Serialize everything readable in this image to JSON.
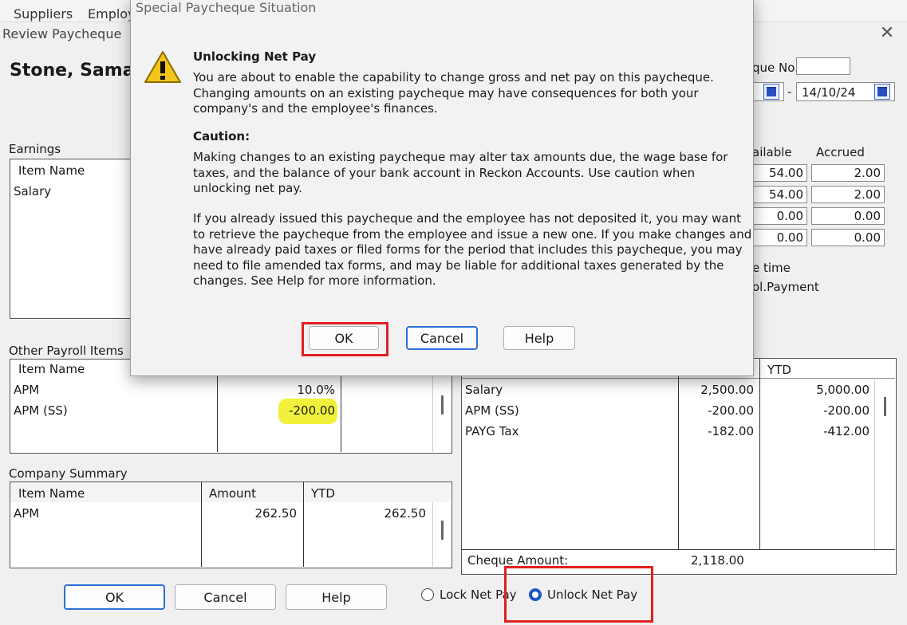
{
  "menubar": {
    "items": [
      "Suppliers",
      "Employ"
    ]
  },
  "background_window": {
    "title": "Review Paycheque",
    "employee_name": "Stone, Sama",
    "cheque_no_label": "que No.",
    "cheque_no_value": "",
    "period_separator": "-",
    "period_end": "14/10/24",
    "earnings": {
      "label": "Earnings",
      "col_item_name": "Item Name",
      "rows": [
        "Salary"
      ]
    },
    "leave": {
      "col_available": "ailable",
      "col_accrued": "Accrued",
      "rows": [
        {
          "available": "54.00",
          "accrued": "2.00"
        },
        {
          "available": "54.00",
          "accrued": "2.00"
        },
        {
          "available": "0.00",
          "accrued": "0.00"
        },
        {
          "available": "0.00",
          "accrued": "0.00"
        }
      ],
      "note1": "e time",
      "note2": "ol.Payment"
    },
    "other_payroll_items": {
      "label": "Other Payroll Items",
      "col_item_name": "Item Name",
      "rows": [
        {
          "name": "APM",
          "rate": "10.0%"
        },
        {
          "name": "APM (SS)",
          "rate": "-200.00"
        }
      ]
    },
    "summary": {
      "col_ytd": "YTD",
      "rows": [
        {
          "name": "Salary",
          "current": "2,500.00",
          "ytd": "5,000.00"
        },
        {
          "name": "APM (SS)",
          "current": "-200.00",
          "ytd": "-200.00"
        },
        {
          "name": "PAYG Tax",
          "current": "-182.00",
          "ytd": "-412.00"
        }
      ],
      "cheque_amount_label": "Cheque Amount:",
      "cheque_amount_value": "2,118.00"
    },
    "company_summary": {
      "label": "Company Summary",
      "col_item_name": "Item Name",
      "col_amount": "Amount",
      "col_ytd": "YTD",
      "rows": [
        {
          "name": "APM",
          "amount": "262.50",
          "ytd": "262.50"
        }
      ]
    },
    "buttons": {
      "ok": "OK",
      "cancel": "Cancel",
      "help": "Help"
    },
    "radio": {
      "lock": "Lock Net Pay",
      "unlock": "Unlock Net Pay",
      "selected": "unlock"
    }
  },
  "dialog": {
    "title": "Special Paycheque Situation",
    "heading": "Unlocking Net Pay",
    "intro": [
      "You are about to enable the capability to change gross and net pay on this paycheque.",
      "Changing amounts on an existing paycheque may have consequences for both your",
      "company's and the employee's finances."
    ],
    "caution_heading": "Caution:",
    "caution": [
      "Making changes to an existing paycheque may alter tax amounts due, the wage base for",
      "taxes, and the balance of your bank account in Reckon Accounts. Use caution when",
      "unlocking net pay."
    ],
    "issued": [
      "If you already issued this paycheque and the employee has not deposited it, you may want",
      "to retrieve the paycheque from the employee and issue a new one. If you make changes and",
      "have already paid taxes or filed forms for the  period that includes this paycheque, you may",
      "need to file amended tax forms, and may be liable for additional taxes generated by the",
      "changes. See Help for more information."
    ],
    "buttons": {
      "ok": "OK",
      "cancel": "Cancel",
      "help": "Help"
    },
    "icon": "warning-icon"
  },
  "colors": {
    "highlight": "#f0f026",
    "annotation_red": "#e02020",
    "accent_blue": "#2a6fd6"
  }
}
